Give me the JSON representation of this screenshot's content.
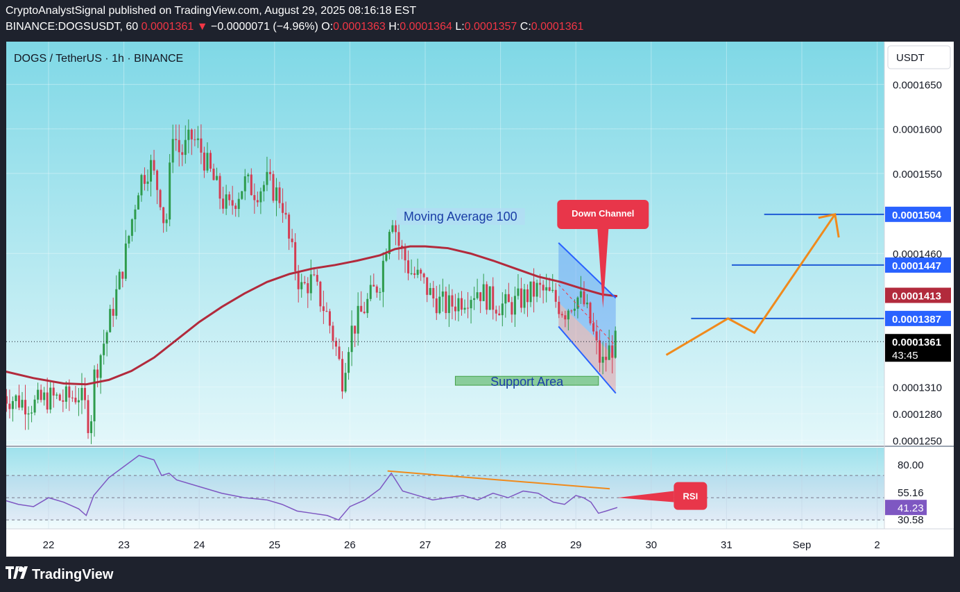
{
  "header": {
    "line1": "CryptoAnalystSignal published on TradingView.com, August 29, 2025 08:16:18 EST",
    "symbol": "BINANCE:DOGSUSDT, 60",
    "last": "0.0001361",
    "change": "−0.0000071 (−4.96%)",
    "o_label": "O:",
    "o": "0.0001363",
    "h_label": "H:",
    "h": "0.0001364",
    "l_label": "L:",
    "l": "0.0001357",
    "c_label": "C:",
    "c": "0.0001361"
  },
  "legend": "DOGS / TetherUS · 1h · BINANCE",
  "currency": "USDT",
  "footer": {
    "brand": "TradingView"
  },
  "annotations": {
    "ma_label": "Moving Average 100",
    "down_channel": "Down Channel",
    "support": "Support Area",
    "rsi": "RSI"
  },
  "colors": {
    "bg_top": "#7fd8e6",
    "bg_bottom": "#f0fbfd",
    "up": "#2e9b4c",
    "down": "#d43c52",
    "ma": "#b22a3c",
    "target": "#1e5bd6",
    "orange": "#f08a1c",
    "rsi": "#7e57c2",
    "callout": "#e8364a"
  },
  "chart_data": [
    {
      "type": "candlestick",
      "title": "DOGS / TetherUS · 1h · BINANCE",
      "x_ticks": [
        "22",
        "23",
        "24",
        "25",
        "26",
        "27",
        "28",
        "29",
        "30",
        "31",
        "Sep",
        "2"
      ],
      "y_ticks": [
        "0.0001650",
        "0.0001600",
        "0.0001550",
        "0.0001460",
        "0.0001310",
        "0.0001280",
        "0.0001250"
      ],
      "ylim": [
        0.0001245,
        0.0001698
      ],
      "price_labels": [
        {
          "value": 0.0001504,
          "text": "0.0001504",
          "role": "target"
        },
        {
          "value": 0.0001447,
          "text": "0.0001447",
          "role": "target"
        },
        {
          "value": 0.0001413,
          "text": "0.0001413",
          "role": "ma"
        },
        {
          "value": 0.0001387,
          "text": "0.0001387",
          "role": "target"
        },
        {
          "value": 0.0001361,
          "text": "0.0001361",
          "role": "last"
        }
      ],
      "countdown": "43:45",
      "targets": [
        0.0001387,
        0.0001447,
        0.0001504
      ],
      "ma_period": 100,
      "ma_series": [
        [
          21.4,
          0.0001328
        ],
        [
          21.8,
          0.000132
        ],
        [
          22.2,
          0.0001314
        ],
        [
          22.5,
          0.0001313
        ],
        [
          22.8,
          0.0001318
        ],
        [
          23.1,
          0.0001328
        ],
        [
          23.4,
          0.0001343
        ],
        [
          23.7,
          0.0001363
        ],
        [
          24.0,
          0.0001383
        ],
        [
          24.3,
          0.00014
        ],
        [
          24.6,
          0.0001415
        ],
        [
          24.9,
          0.0001428
        ],
        [
          25.2,
          0.0001437
        ],
        [
          25.5,
          0.0001443
        ],
        [
          25.8,
          0.0001447
        ],
        [
          26.1,
          0.0001452
        ],
        [
          26.4,
          0.0001458
        ],
        [
          26.6,
          0.0001465
        ],
        [
          26.8,
          0.0001468
        ],
        [
          27.0,
          0.0001468
        ],
        [
          27.3,
          0.0001466
        ],
        [
          27.6,
          0.000146
        ],
        [
          27.9,
          0.0001452
        ],
        [
          28.2,
          0.0001443
        ],
        [
          28.5,
          0.0001434
        ],
        [
          28.8,
          0.0001428
        ],
        [
          29.1,
          0.000142
        ],
        [
          29.35,
          0.0001414
        ],
        [
          29.55,
          0.0001412
        ]
      ],
      "close_path": [
        [
          21.4,
          0.00013
        ],
        [
          21.6,
          0.0001295
        ],
        [
          21.8,
          0.000129
        ],
        [
          22.0,
          0.0001298
        ],
        [
          22.2,
          0.0001296
        ],
        [
          22.4,
          0.0001302
        ],
        [
          22.5,
          0.0001285
        ],
        [
          22.55,
          0.000126
        ],
        [
          22.6,
          0.000132
        ],
        [
          22.8,
          0.000138
        ],
        [
          23.0,
          0.000145
        ],
        [
          23.2,
          0.000154
        ],
        [
          23.35,
          0.000156
        ],
        [
          23.5,
          0.000152
        ],
        [
          23.55,
          0.000148
        ],
        [
          23.65,
          0.00016
        ],
        [
          23.75,
          0.000157
        ],
        [
          23.9,
          0.000159
        ],
        [
          24.0,
          0.000158
        ],
        [
          24.1,
          0.000156
        ],
        [
          24.3,
          0.000152
        ],
        [
          24.4,
          0.000151
        ],
        [
          24.6,
          0.000154
        ],
        [
          24.75,
          0.000153
        ],
        [
          24.9,
          0.000154
        ],
        [
          25.1,
          0.000152
        ],
        [
          25.2,
          0.000147
        ],
        [
          25.35,
          0.000142
        ],
        [
          25.5,
          0.000143
        ],
        [
          25.7,
          0.000139
        ],
        [
          25.8,
          0.000136
        ],
        [
          25.9,
          0.000132
        ],
        [
          26.0,
          0.000137
        ],
        [
          26.2,
          0.00014
        ],
        [
          26.4,
          0.000143
        ],
        [
          26.5,
          0.000148
        ],
        [
          26.55,
          0.000151
        ],
        [
          26.65,
          0.000147
        ],
        [
          26.8,
          0.000144
        ],
        [
          26.95,
          0.000143
        ],
        [
          27.1,
          0.000141
        ],
        [
          27.3,
          0.00014
        ],
        [
          27.5,
          0.000141
        ],
        [
          27.7,
          0.000142
        ],
        [
          27.9,
          0.0001405
        ],
        [
          28.1,
          0.00014
        ],
        [
          28.3,
          0.000141
        ],
        [
          28.5,
          0.000142
        ],
        [
          28.7,
          0.000141
        ],
        [
          28.85,
          0.0001395
        ],
        [
          29.0,
          0.0001412
        ],
        [
          29.1,
          0.0001405
        ],
        [
          29.2,
          0.000138
        ],
        [
          29.3,
          0.0001345
        ],
        [
          29.35,
          0.0001335
        ],
        [
          29.45,
          0.0001352
        ],
        [
          29.55,
          0.0001361
        ]
      ]
    },
    {
      "type": "line",
      "title": "RSI",
      "y_ticks": [
        "80.00",
        "30.58"
      ],
      "levels": [
        70,
        50,
        30
      ],
      "value_labels": [
        {
          "value": 55.16,
          "text": "55.16"
        },
        {
          "value": 41.23,
          "text": "41.23"
        }
      ],
      "ylim": [
        22,
        95
      ],
      "series": [
        [
          21.4,
          48
        ],
        [
          21.6,
          44
        ],
        [
          21.8,
          42
        ],
        [
          22.0,
          50
        ],
        [
          22.2,
          46
        ],
        [
          22.4,
          40
        ],
        [
          22.5,
          34
        ],
        [
          22.6,
          52
        ],
        [
          22.8,
          68
        ],
        [
          23.0,
          78
        ],
        [
          23.2,
          88
        ],
        [
          23.4,
          84
        ],
        [
          23.5,
          70
        ],
        [
          23.6,
          72
        ],
        [
          23.7,
          66
        ],
        [
          24.0,
          60
        ],
        [
          24.3,
          54
        ],
        [
          24.6,
          50
        ],
        [
          24.9,
          48
        ],
        [
          25.1,
          44
        ],
        [
          25.3,
          38
        ],
        [
          25.5,
          36
        ],
        [
          25.7,
          34
        ],
        [
          25.85,
          30
        ],
        [
          26.0,
          42
        ],
        [
          26.2,
          48
        ],
        [
          26.4,
          58
        ],
        [
          26.55,
          72
        ],
        [
          26.7,
          56
        ],
        [
          26.9,
          52
        ],
        [
          27.1,
          48
        ],
        [
          27.3,
          50
        ],
        [
          27.5,
          52
        ],
        [
          27.7,
          48
        ],
        [
          27.9,
          54
        ],
        [
          28.1,
          50
        ],
        [
          28.3,
          56
        ],
        [
          28.5,
          54
        ],
        [
          28.7,
          46
        ],
        [
          28.85,
          44
        ],
        [
          29.0,
          52
        ],
        [
          29.1,
          50
        ],
        [
          29.2,
          46
        ],
        [
          29.3,
          36
        ],
        [
          29.4,
          38
        ],
        [
          29.55,
          41.23
        ]
      ]
    }
  ]
}
